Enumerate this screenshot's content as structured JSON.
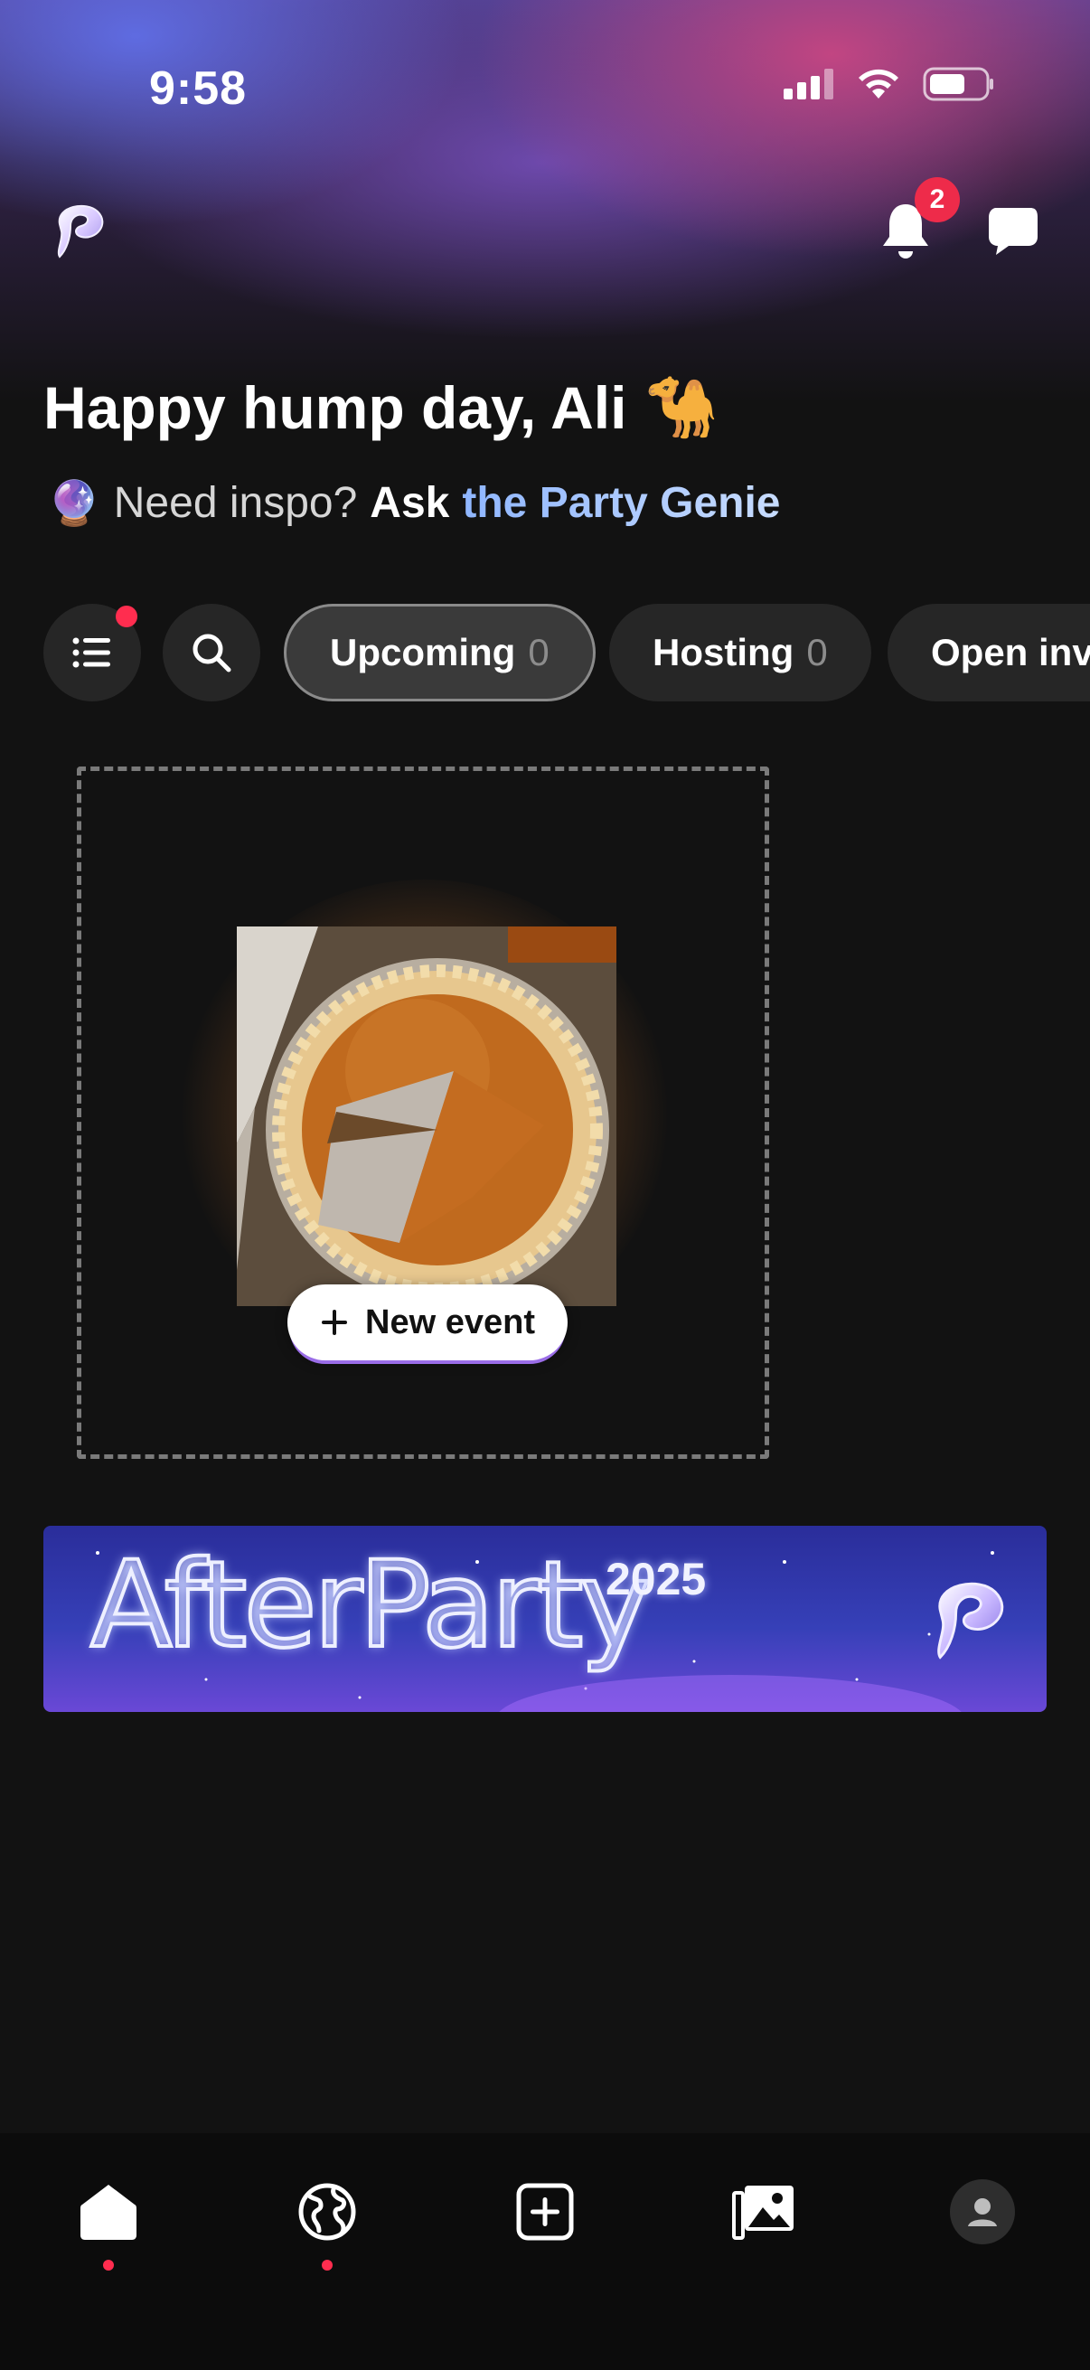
{
  "status_bar": {
    "time": "9:58"
  },
  "header": {
    "notifications_count": "2"
  },
  "greeting": {
    "text": "Happy hump day, Ali",
    "emoji": "🐪"
  },
  "inspo": {
    "emoji": "🔮",
    "prompt": "Need inspo?",
    "ask": "Ask",
    "genie": "the Party Genie"
  },
  "filters": {
    "chips": [
      {
        "label": "Upcoming",
        "count": "0"
      },
      {
        "label": "Hosting",
        "count": "0"
      },
      {
        "label": "Open inv",
        "count": ""
      }
    ]
  },
  "new_event": {
    "button_label": "New event"
  },
  "banner": {
    "title": "AfterParty",
    "year": "2025"
  },
  "colors": {
    "background": "#121212",
    "accent_red": "#ee2b4a",
    "chip_bg": "#262626"
  },
  "bottom_nav": {
    "items": [
      "home-icon",
      "globe-icon",
      "add-square-icon",
      "gallery-icon",
      "profile-avatar"
    ]
  }
}
